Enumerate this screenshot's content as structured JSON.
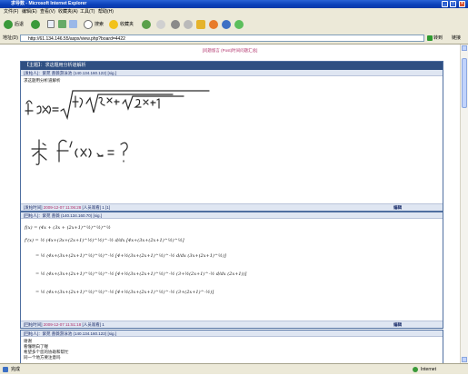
{
  "window": {
    "title": "求导数 - Microsoft Internet Explorer"
  },
  "menu": [
    "文件(F)",
    "编辑(E)",
    "查看(V)",
    "收藏夹(A)",
    "工具(T)",
    "帮助(H)"
  ],
  "toolbar": {
    "back": "后退",
    "search": "搜索",
    "favorites": "收藏夹"
  },
  "address": {
    "label": "地址(D)",
    "url": "http://61.134.146.55/aspx/view.php?board=4422",
    "go": "转到",
    "links": "链接"
  },
  "page": {
    "top_link": "[问题留言 (Post)时间问题汇总]"
  },
  "posts": [
    {
      "header": "【主题】：求这题用分析道解析",
      "meta": "[发帖人]：紫苑 蔷薇游泳池 (140.134.160.122) [sig.]",
      "subtitle": "求这题用分析道解析",
      "hw_line1": "f(x)= √(4x+√(3x+√(2x+1))))",
      "hw_line2": "求 f'(x) = ?",
      "footer_time": "2009-12-07 11:06:28",
      "footer_extra": "[人员观看] 1 [1]",
      "edit": "编辑"
    },
    {
      "header": "",
      "meta": "[回帖人]：紫苑 蔷薇 (140.134.160.70) [sig.]",
      "math": [
        "f(x) = (4x + (3x + (2x+1)^½)^½)^½",
        "f'(x) = ½ (4x+(3x+(2x+1)^½)^½)^-½ d/dx [4x+(3x+(2x+1)^½)^½]",
        "= ½ (4x+(3x+(2x+1)^½)^½)^-½ [4+½(3x+(2x+1)^½)^-½ d/dx (3x+(2x+1)^½)]",
        "= ½ (4x+(3x+(2x+1)^½)^½)^-½ [4+½(3x+(2x+1)^½)^-½ (3+½(2x+1)^-½ d/dx (2x+1))]",
        "= ½ (4x+(3x+(2x+1)^½)^½)^-½ [4+½(3x+(2x+1)^½)^-½ (3+(2x+1)^-½)]"
      ],
      "footer_time": "2009-12-07 11:51:18",
      "footer_extra": "[人员观看] 1",
      "edit": "编辑"
    },
    {
      "meta": "[回帖人]：紫苑 蔷薇游泳池 (140.134.160.122) [sig.]",
      "lines": [
        "谢谢",
        "看懂明白了喔",
        "希望多个您的协助和帮忙",
        "同一个地方要注意吗"
      ]
    }
  ],
  "status": {
    "left": "完成",
    "right": "Internet"
  }
}
